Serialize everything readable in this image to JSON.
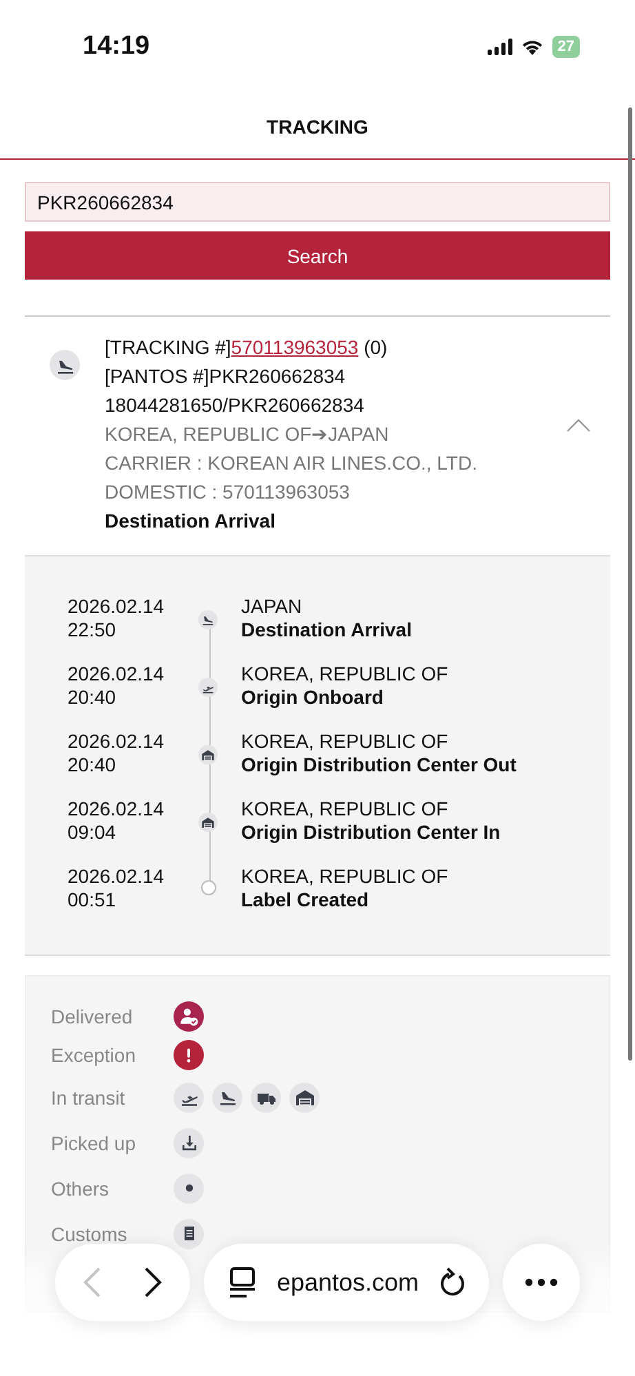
{
  "status_bar": {
    "time": "14:19",
    "battery": "27"
  },
  "header": {
    "title": "TRACKING"
  },
  "search": {
    "value": "PKR260662834",
    "button": "Search"
  },
  "shipment": {
    "expanded": true,
    "tracking_label": "[TRACKING #]",
    "tracking_link": "570113963053",
    "tracking_count": "(0)",
    "lines": [
      {
        "text": "[PANTOS #]PKR260662834",
        "kind": "dark"
      },
      {
        "text": "18044281650/PKR260662834",
        "kind": "dark"
      },
      {
        "text": "KOREA, REPUBLIC OF➔JAPAN",
        "kind": "muted"
      },
      {
        "text": "CARRIER : KOREAN AIR LINES.CO., LTD.",
        "kind": "muted"
      },
      {
        "text": "DOMESTIC : 570113963053",
        "kind": "muted"
      },
      {
        "text": "Destination Arrival",
        "kind": "status"
      }
    ]
  },
  "events": [
    {
      "date": "2026.02.14",
      "time": "22:50",
      "place": "JAPAN",
      "status": "Destination Arrival",
      "kind": "arrival"
    },
    {
      "date": "2026.02.14",
      "time": "20:40",
      "place": "KOREA, REPUBLIC OF",
      "status": "Origin Onboard",
      "kind": "departure"
    },
    {
      "date": "2026.02.14",
      "time": "20:40",
      "place": "KOREA, REPUBLIC OF",
      "status": "Origin Distribution Center Out",
      "kind": "warehouse"
    },
    {
      "date": "2026.02.14",
      "time": "09:04",
      "place": "KOREA, REPUBLIC OF",
      "status": "Origin Distribution Center In",
      "kind": "warehouse"
    },
    {
      "date": "2026.02.14",
      "time": "00:51",
      "place": "KOREA, REPUBLIC OF",
      "status": "Label Created",
      "kind": "created"
    }
  ],
  "legend": [
    {
      "label": "Delivered",
      "kind": "delivered"
    },
    {
      "label": "Exception",
      "kind": "exception"
    },
    {
      "label": "In transit",
      "kind": "transit"
    },
    {
      "label": "Picked up",
      "kind": "pickup"
    },
    {
      "label": "Others",
      "kind": "other"
    },
    {
      "label": "Customs",
      "kind": "customs"
    }
  ],
  "browser": {
    "url": "epantos.com",
    "back_disabled": true,
    "forward_disabled": false
  }
}
